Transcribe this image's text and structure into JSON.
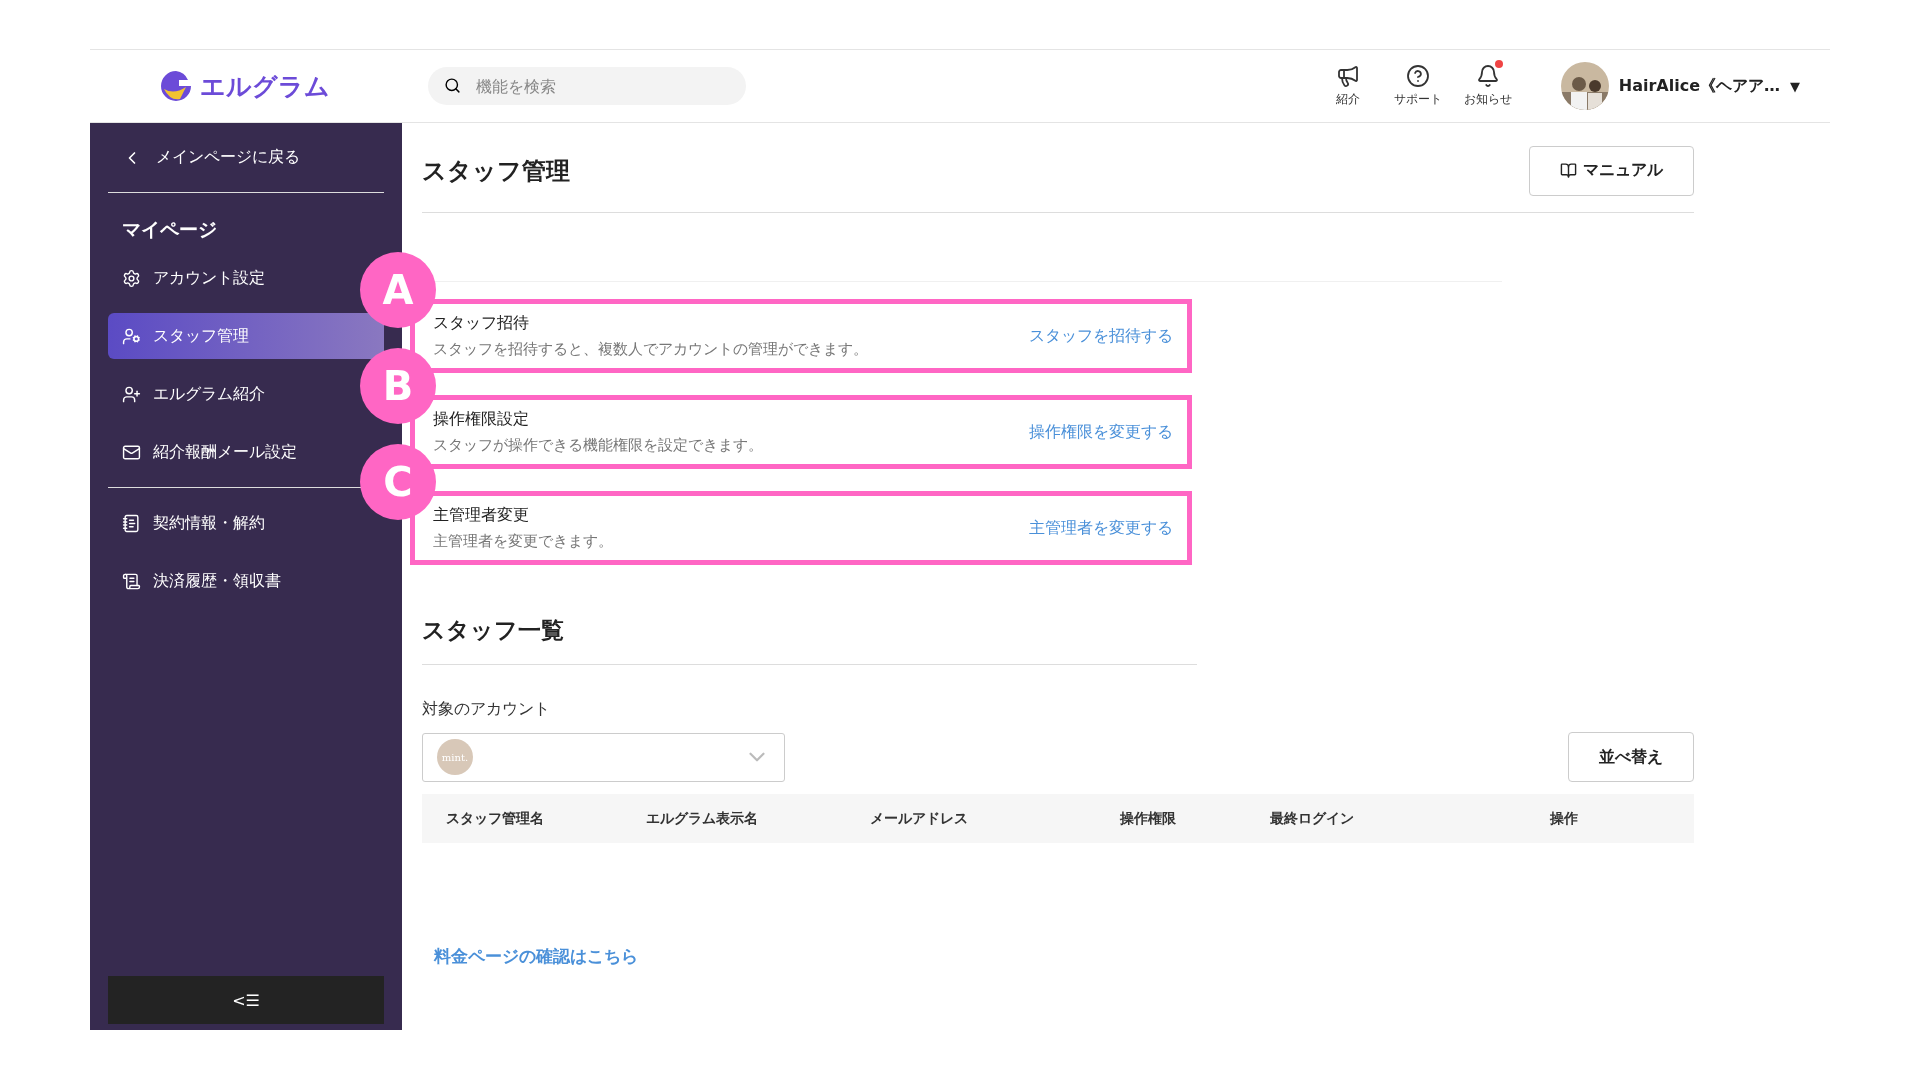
{
  "header": {
    "logo": "エルグラム",
    "search": {
      "placeholder": "機能を検索"
    },
    "actions": [
      {
        "kind": "megaphone",
        "label": "紹介",
        "badge": false
      },
      {
        "kind": "help",
        "label": "サポート",
        "badge": false
      },
      {
        "kind": "bell",
        "label": "お知らせ",
        "badge": true
      }
    ],
    "user": {
      "name": "HairAlice《ヘアア…",
      "caret": "▼"
    }
  },
  "sidebar": {
    "back": "メインページに戻る",
    "section": "マイページ",
    "items": [
      {
        "kind": "gear",
        "label": "アカウント設定",
        "selected": false
      },
      {
        "kind": "staff",
        "label": "スタッフ管理",
        "selected": true
      },
      {
        "kind": "invite",
        "label": "エルグラム紹介",
        "selected": false
      },
      {
        "kind": "mail",
        "label": "紹介報酬メール設定",
        "selected": false
      }
    ],
    "items2": [
      {
        "kind": "contract",
        "label": "契約情報・解約",
        "selected": false
      },
      {
        "kind": "receipt",
        "label": "決済履歴・領収書",
        "selected": false
      }
    ],
    "collapse": "<☰"
  },
  "main": {
    "title": "スタッフ管理",
    "manual": "マニュアル",
    "cards": [
      {
        "marker": "A",
        "title": "スタッフ招待",
        "description": "スタッフを招待すると、複数人でアカウントの管理ができます。",
        "action": "スタッフを招待する"
      },
      {
        "marker": "B",
        "title": "操作権限設定",
        "description": "スタッフが操作できる機能権限を設定できます。",
        "action": "操作権限を変更する"
      },
      {
        "marker": "C",
        "title": "主管理者変更",
        "description": "主管理者を変更できます。",
        "action": "主管理者を変更する"
      }
    ],
    "list_title": "スタッフ一覧",
    "account_label": "対象のアカウント",
    "account_avatar": "mint.",
    "sort": "並べ替え",
    "columns": [
      "スタッフ管理名",
      "エルグラム表示名",
      "メールアドレス",
      "操作権限",
      "最終ログイン",
      "操作"
    ],
    "pricing_link": "料金ページの確認はこちら"
  }
}
